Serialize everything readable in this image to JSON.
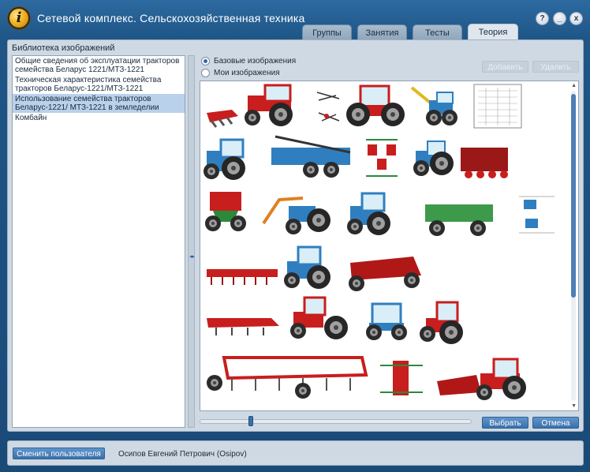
{
  "app": {
    "title": "Сетевой комплекс. Сельскохозяйственная техника",
    "logo_letter": "i",
    "help_label": "?",
    "minimize_label": "_",
    "close_label": "x"
  },
  "tabs": [
    {
      "label": "Группы",
      "active": false
    },
    {
      "label": "Занятия",
      "active": false
    },
    {
      "label": "Тесты",
      "active": false
    },
    {
      "label": "Теория",
      "active": true
    }
  ],
  "library": {
    "title": "Библиотека изображений",
    "items": [
      {
        "label": "Общие сведения об эксплуатации тракторов семейства Беларус 1221/МТЗ-1221",
        "selected": false
      },
      {
        "label": "Техническая характеристика семейства тракторов Беларус-1221/МТЗ-1221",
        "selected": false
      },
      {
        "label": "Использование семейства тракторов Беларус-1221/ МТЗ-1221 в земледелии",
        "selected": true
      },
      {
        "label": "Комбайн",
        "selected": false
      }
    ]
  },
  "splitter": {
    "arrow_icon": "left-right-arrows-icon",
    "glyph": "◂▸"
  },
  "image_source": {
    "base_label": "Базовые изображения",
    "my_label": "Мои изображения",
    "selected": "base"
  },
  "actions": {
    "add_label": "Добавить",
    "delete_label": "Удалить",
    "select_label": "Выбрать",
    "cancel_label": "Отмена"
  },
  "gallery": {
    "thumbnail_count": 21,
    "scroll_up_glyph": "▲",
    "scroll_down_glyph": "▼"
  },
  "footer": {
    "switch_user_label": "Сменить пользователя",
    "user_name": "Осипов Евгений Петрович (Osipov)"
  },
  "colors": {
    "title_bar": "#2d6aa0",
    "panel": "#cfd9e3",
    "primary_button": "#3b71ab",
    "selection": "#b9d1ea",
    "tractor_red": "#c81e1e",
    "tractor_blue": "#2f7fc0"
  }
}
